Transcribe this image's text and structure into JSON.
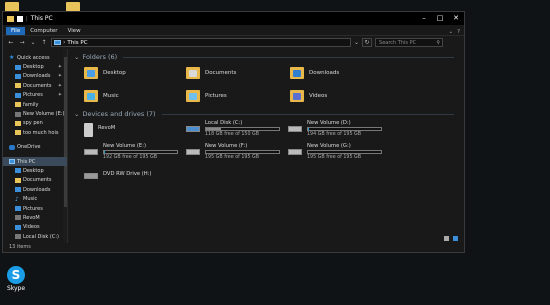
{
  "window": {
    "title": "This PC"
  },
  "ribbon": {
    "tabs": [
      "File",
      "Computer",
      "View"
    ]
  },
  "address": {
    "path": "This PC",
    "search_placeholder": "Search This PC"
  },
  "nav": {
    "items": [
      {
        "label": "Quick access",
        "icon": "star-icon",
        "pin": false
      },
      {
        "label": "Desktop",
        "icon": "desktop-folder-icon",
        "pin": true
      },
      {
        "label": "Downloads",
        "icon": "download-folder-icon",
        "pin": true
      },
      {
        "label": "Documents",
        "icon": "document-folder-icon",
        "pin": true
      },
      {
        "label": "Pictures",
        "icon": "pictures-folder-icon",
        "pin": true
      },
      {
        "label": "family",
        "icon": "folder-icon",
        "pin": false
      },
      {
        "label": "New Volume (E:)",
        "icon": "drive-icon",
        "pin": false
      },
      {
        "label": "spy pen",
        "icon": "folder-icon",
        "pin": false
      },
      {
        "label": "too much hois",
        "icon": "folder-icon",
        "pin": false
      },
      {
        "label": "OneDrive",
        "icon": "cloud-icon",
        "pin": false
      },
      {
        "label": "This PC",
        "icon": "pc-icon",
        "pin": false
      },
      {
        "label": "Desktop",
        "icon": "desktop-folder-icon",
        "pin": false
      },
      {
        "label": "Documents",
        "icon": "document-folder-icon",
        "pin": false
      },
      {
        "label": "Downloads",
        "icon": "download-folder-icon",
        "pin": false
      },
      {
        "label": "Music",
        "icon": "music-icon",
        "pin": false
      },
      {
        "label": "Pictures",
        "icon": "pictures-folder-icon",
        "pin": false
      },
      {
        "label": "RevoM",
        "icon": "device-icon",
        "pin": false
      },
      {
        "label": "Videos",
        "icon": "videos-folder-icon",
        "pin": false
      },
      {
        "label": "Local Disk (C:)",
        "icon": "drive-icon",
        "pin": false
      }
    ]
  },
  "status": {
    "count": "13 items"
  },
  "folders": {
    "header": "Folders (6)",
    "items": [
      {
        "label": "Desktop",
        "glyph_color": "#4a9ee8"
      },
      {
        "label": "Documents",
        "glyph_color": "#d9d9d9"
      },
      {
        "label": "Downloads",
        "glyph_color": "#2f7fd0"
      },
      {
        "label": "Music",
        "glyph_color": "#4ab0e8"
      },
      {
        "label": "Pictures",
        "glyph_color": "#6fc0ee"
      },
      {
        "label": "Videos",
        "glyph_color": "#5a6fd0"
      }
    ]
  },
  "drives": {
    "header": "Devices and drives (7)",
    "items": [
      {
        "label": "RevoM",
        "type": "device",
        "usage": "",
        "fill": 0
      },
      {
        "label": "Local Disk (C:)",
        "type": "hdd",
        "usage": "118 GB free of 150 GB",
        "fill": 0.21
      },
      {
        "label": "New Volume (D:)",
        "type": "hdd",
        "usage": "194 GB free of 195 GB",
        "fill": 0.01
      },
      {
        "label": "New Volume (E:)",
        "type": "hdd",
        "usage": "192 GB free of 195 GB",
        "fill": 0.02
      },
      {
        "label": "New Volume (F:)",
        "type": "hdd",
        "usage": "195 GB free of 195 GB",
        "fill": 0.0
      },
      {
        "label": "New Volume (G:)",
        "type": "hdd",
        "usage": "195 GB free of 195 GB",
        "fill": 0.0
      },
      {
        "label": "DVD RW Drive (H:)",
        "type": "dvd",
        "usage": "",
        "fill": 0
      }
    ]
  },
  "desktop": {
    "skype_label": "Skype"
  }
}
